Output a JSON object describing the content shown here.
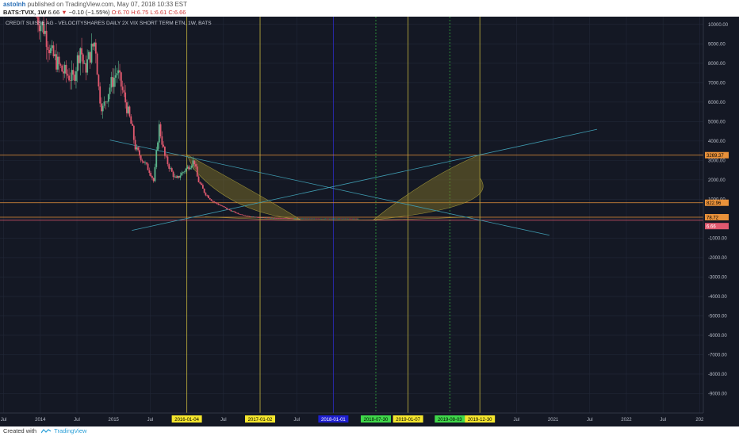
{
  "header": {
    "author": "astolnh",
    "published": "published on TradingView.com, May 07, 2018 10:33 EST",
    "symbol": "BATS:TVIX, 1W",
    "last": "6.66",
    "arrow": "▼",
    "change": "−0.10 (−1.55%)",
    "open": "O:6.70",
    "high": "H:6.75",
    "low": "L:6.61",
    "close": "C:6.66"
  },
  "chart_title": "CREDIT SUISSE AG - VELOCITYSHARES DAILY 2X VIX SHORT TERM ETN, 1W, BATS",
  "footer": {
    "created": "Created with",
    "brand": "TradingView"
  },
  "colors": {
    "background": "#141824",
    "grid": "#222838",
    "up": "#5cb88e",
    "down": "#e0596f",
    "vline": "#b3a63c",
    "arc_fill": "#8a7a2a",
    "orange": "#e8913a",
    "cyan": "#3f9bb0"
  },
  "chart_data": {
    "type": "candlestick",
    "title": "CREDIT SUISSE AG - VELOCITYSHARES DAILY 2X VIX SHORT TERM ETN, 1W, BATS",
    "ylim": [
      -10000,
      10400
    ],
    "y_ticks": [
      "10000.00",
      "9000.00",
      "8000.00",
      "7000.00",
      "6000.00",
      "5000.00",
      "4000.00",
      "3000.00",
      "2000.00",
      "1000.00",
      "-1000.00",
      "-2000.00",
      "-3000.00",
      "-4000.00",
      "-5000.00",
      "-6000.00",
      "-7000.00",
      "-8000.00",
      "-9000.00"
    ],
    "x_ticks": [
      {
        "label": "Jul",
        "t": 2013.5
      },
      {
        "label": "2014",
        "t": 2014.0
      },
      {
        "label": "Jul",
        "t": 2014.5
      },
      {
        "label": "2015",
        "t": 2015.0
      },
      {
        "label": "Jul",
        "t": 2015.5
      },
      {
        "label": "2016-01-04",
        "t": 2016.0,
        "bg": "#f5e62d",
        "fg": "#000000"
      },
      {
        "label": "Jul",
        "t": 2016.5
      },
      {
        "label": "2017-01-02",
        "t": 2017.0,
        "bg": "#f5e62d",
        "fg": "#000000"
      },
      {
        "label": "Jul",
        "t": 2017.5
      },
      {
        "label": "2018-01-01",
        "t": 2018.0,
        "bg": "#1f1fd0",
        "fg": "#ffffff"
      },
      {
        "label": "2018-07-30",
        "t": 2018.58,
        "bg": "#3fd84a",
        "fg": "#000000"
      },
      {
        "label": "2019-01-07",
        "t": 2019.02,
        "bg": "#f5e62d",
        "fg": "#000000"
      },
      {
        "label": "2019-08-03",
        "t": 2019.59,
        "bg": "#3fd84a",
        "fg": "#000000"
      },
      {
        "label": "2019-12-30",
        "t": 2020.0,
        "bg": "#f5e62d",
        "fg": "#000000"
      },
      {
        "label": "Jul",
        "t": 2020.5
      },
      {
        "label": "2021",
        "t": 2021.0
      },
      {
        "label": "Jul",
        "t": 2021.5
      },
      {
        "label": "2022",
        "t": 2022.0
      },
      {
        "label": "Jul",
        "t": 2022.5
      },
      {
        "label": "202",
        "t": 2023.0
      }
    ],
    "vertical_lines": [
      {
        "t": 2016.0,
        "color": "#b3a63c",
        "style": "solid"
      },
      {
        "t": 2017.0,
        "color": "#b3a63c",
        "style": "solid"
      },
      {
        "t": 2018.0,
        "color": "#2a2ab8",
        "style": "solid"
      },
      {
        "t": 2018.58,
        "color": "#2f9a3a",
        "style": "dotted"
      },
      {
        "t": 2019.02,
        "color": "#b3a63c",
        "style": "solid"
      },
      {
        "t": 2019.59,
        "color": "#2f9a3a",
        "style": "dotted"
      },
      {
        "t": 2020.0,
        "color": "#b3a63c",
        "style": "solid"
      }
    ],
    "horizontal_lines": [
      {
        "y": 3270,
        "color": "#e8913a"
      },
      {
        "y": 822.96,
        "color": "#e8913a"
      },
      {
        "y": 78,
        "color": "#e8913a"
      },
      {
        "y": -80,
        "color": "#e0596f"
      }
    ],
    "price_labels": [
      {
        "text": "3269.37",
        "y": 3270,
        "bg": "#e8913a",
        "fg": "#000000"
      },
      {
        "text": "822.96",
        "y": 822.96,
        "bg": "#e8913a",
        "fg": "#000000"
      },
      {
        "text": "78.72",
        "y": 78,
        "bg": "#e8913a",
        "fg": "#000000"
      },
      {
        "text": "6.66",
        "y": -380,
        "bg": "#e0596f",
        "fg": "#ffffff"
      }
    ],
    "trend_lines": [
      {
        "x1": 2014.95,
        "y1": 4050,
        "x2": 2020.95,
        "y2": -850,
        "color": "#3f9bb0"
      },
      {
        "x1": 2015.25,
        "y1": -600,
        "x2": 2021.6,
        "y2": 4600,
        "color": "#3f9bb0"
      }
    ],
    "arcs": [
      {
        "apex_t": 2016.0,
        "apex_y": 3300,
        "mid_t": 2017.55,
        "end_t": 2016.3,
        "end_y": -50
      },
      {
        "apex_t": 2020.0,
        "apex_y": 3300,
        "mid_t": 2018.55,
        "end_t": 2019.8,
        "end_y": -50
      }
    ],
    "series": [
      {
        "t": 2013.95,
        "close": 10400
      },
      {
        "t": 2014.05,
        "close": 9800
      },
      {
        "t": 2014.15,
        "close": 8500
      },
      {
        "t": 2014.3,
        "close": 7600
      },
      {
        "t": 2014.45,
        "close": 7200
      },
      {
        "t": 2014.55,
        "close": 8900
      },
      {
        "t": 2014.6,
        "close": 7600
      },
      {
        "t": 2014.75,
        "close": 9200
      },
      {
        "t": 2014.8,
        "close": 6500
      },
      {
        "t": 2014.85,
        "close": 5600
      },
      {
        "t": 2014.95,
        "close": 6800
      },
      {
        "t": 2015.05,
        "close": 7600
      },
      {
        "t": 2015.15,
        "close": 6200
      },
      {
        "t": 2015.25,
        "close": 4700
      },
      {
        "t": 2015.3,
        "close": 3600
      },
      {
        "t": 2015.4,
        "close": 3000
      },
      {
        "t": 2015.5,
        "close": 2400
      },
      {
        "t": 2015.55,
        "close": 1900
      },
      {
        "t": 2015.62,
        "close": 4800
      },
      {
        "t": 2015.7,
        "close": 3200
      },
      {
        "t": 2015.78,
        "close": 2500
      },
      {
        "t": 2015.85,
        "close": 2000
      },
      {
        "t": 2015.92,
        "close": 2300
      },
      {
        "t": 2016.0,
        "close": 2600
      },
      {
        "t": 2016.1,
        "close": 3000
      },
      {
        "t": 2016.15,
        "close": 2000
      },
      {
        "t": 2016.25,
        "close": 1300
      },
      {
        "t": 2016.35,
        "close": 900
      },
      {
        "t": 2016.45,
        "close": 700
      },
      {
        "t": 2016.55,
        "close": 500
      },
      {
        "t": 2016.7,
        "close": 250
      },
      {
        "t": 2016.85,
        "close": 120
      },
      {
        "t": 2017.0,
        "close": 60
      },
      {
        "t": 2017.25,
        "close": 30
      },
      {
        "t": 2017.5,
        "close": 15
      },
      {
        "t": 2017.8,
        "close": 8
      },
      {
        "t": 2018.1,
        "close": 10
      },
      {
        "t": 2018.35,
        "close": 7
      }
    ]
  }
}
